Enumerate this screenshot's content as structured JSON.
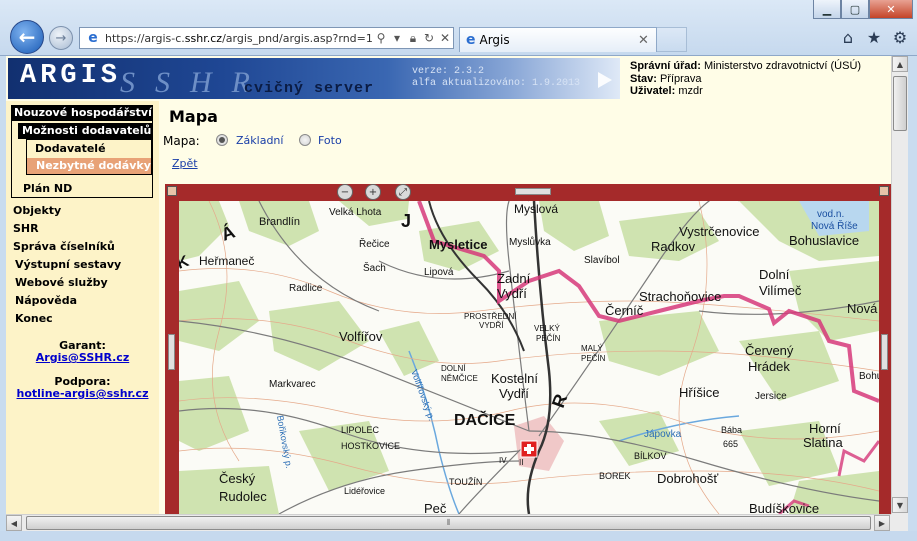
{
  "browser": {
    "url_prefix": "https://argis-c.",
    "url_domain": "sshr.cz",
    "url_rest": "/argis_pnd/argis.asp?rnd=15",
    "tab_title": "Argis"
  },
  "header": {
    "logo_text": "ARGIS",
    "logo_sub": "SSHR",
    "server_label": "cvičný server",
    "version": "verze: 2.3.2",
    "updated": "alfa aktualizováno: 1.9.2013",
    "office_label": "Správní úřad:",
    "office_value": "Ministerstvo zdravotnictví (ÚSÚ)",
    "status_label": "Stav:",
    "status_value": "Příprava",
    "user_label": "Uživatel:",
    "user_value": "mzdr"
  },
  "sidebar": {
    "section": "Nouzové hospodářství",
    "subsection": "Možnosti dodavatelů",
    "items_sub": [
      "Dodavatelé",
      "Nezbytné dodávky"
    ],
    "plan": "Plán ND",
    "items": [
      "Objekty",
      "SHR",
      "Správa číselníků",
      "Výstupní sestavy",
      "Webové služby",
      "Nápověda",
      "Konec"
    ],
    "garant_label": "Garant:",
    "garant_email": "Argis@SSHR.cz",
    "support_label": "Podpora:",
    "support_email": "hotline-argis@sshr.cz"
  },
  "main": {
    "title": "Mapa",
    "map_label": "Mapa:",
    "option_basic": "Základní",
    "option_photo": "Foto",
    "back_link": "Zpět"
  },
  "map_labels": [
    "Brandlín",
    "Velká Lhota",
    "Myslová",
    "Mysletice",
    "Myslůvka",
    "Radkov",
    "Vystrčenovice",
    "Bohuslavice",
    "vod.n.",
    "Nová Říše",
    "Heřmaneč",
    "Řečice",
    "Šach",
    "Lipová",
    "Zadní",
    "Vydří",
    "Slavíbol",
    "Strachoňovice",
    "Dolní",
    "Vilímeč",
    "Nová R",
    "Radlice",
    "Černíč",
    "PROSTŘEDNÍ",
    "VYDŘÍ",
    "VELKÝ",
    "PEČÍN",
    "Volfířov",
    "MALÝ",
    "PEČÍN",
    "Červený",
    "Hrádek",
    "Markvarec",
    "DOLNÍ",
    "NĚMČICE",
    "Kostelní",
    "Vydří",
    "Hříšice",
    "Jersice",
    "Volfířovský p.",
    "DAČICE",
    "Bořikovský p.",
    "LIPOLEC",
    "HOSTKOVICE",
    "Horní",
    "Slatina",
    "Bába",
    "665",
    "Jápovka",
    "BOREK",
    "BÍLKOV",
    "Dobrohošť",
    "Lidéřovice",
    "TOUŽÍN",
    "Český",
    "Rudolec",
    "Peč",
    "Budíškovice",
    "IV",
    "II",
    "Bohu",
    "Á",
    "J",
    "R",
    "K"
  ]
}
